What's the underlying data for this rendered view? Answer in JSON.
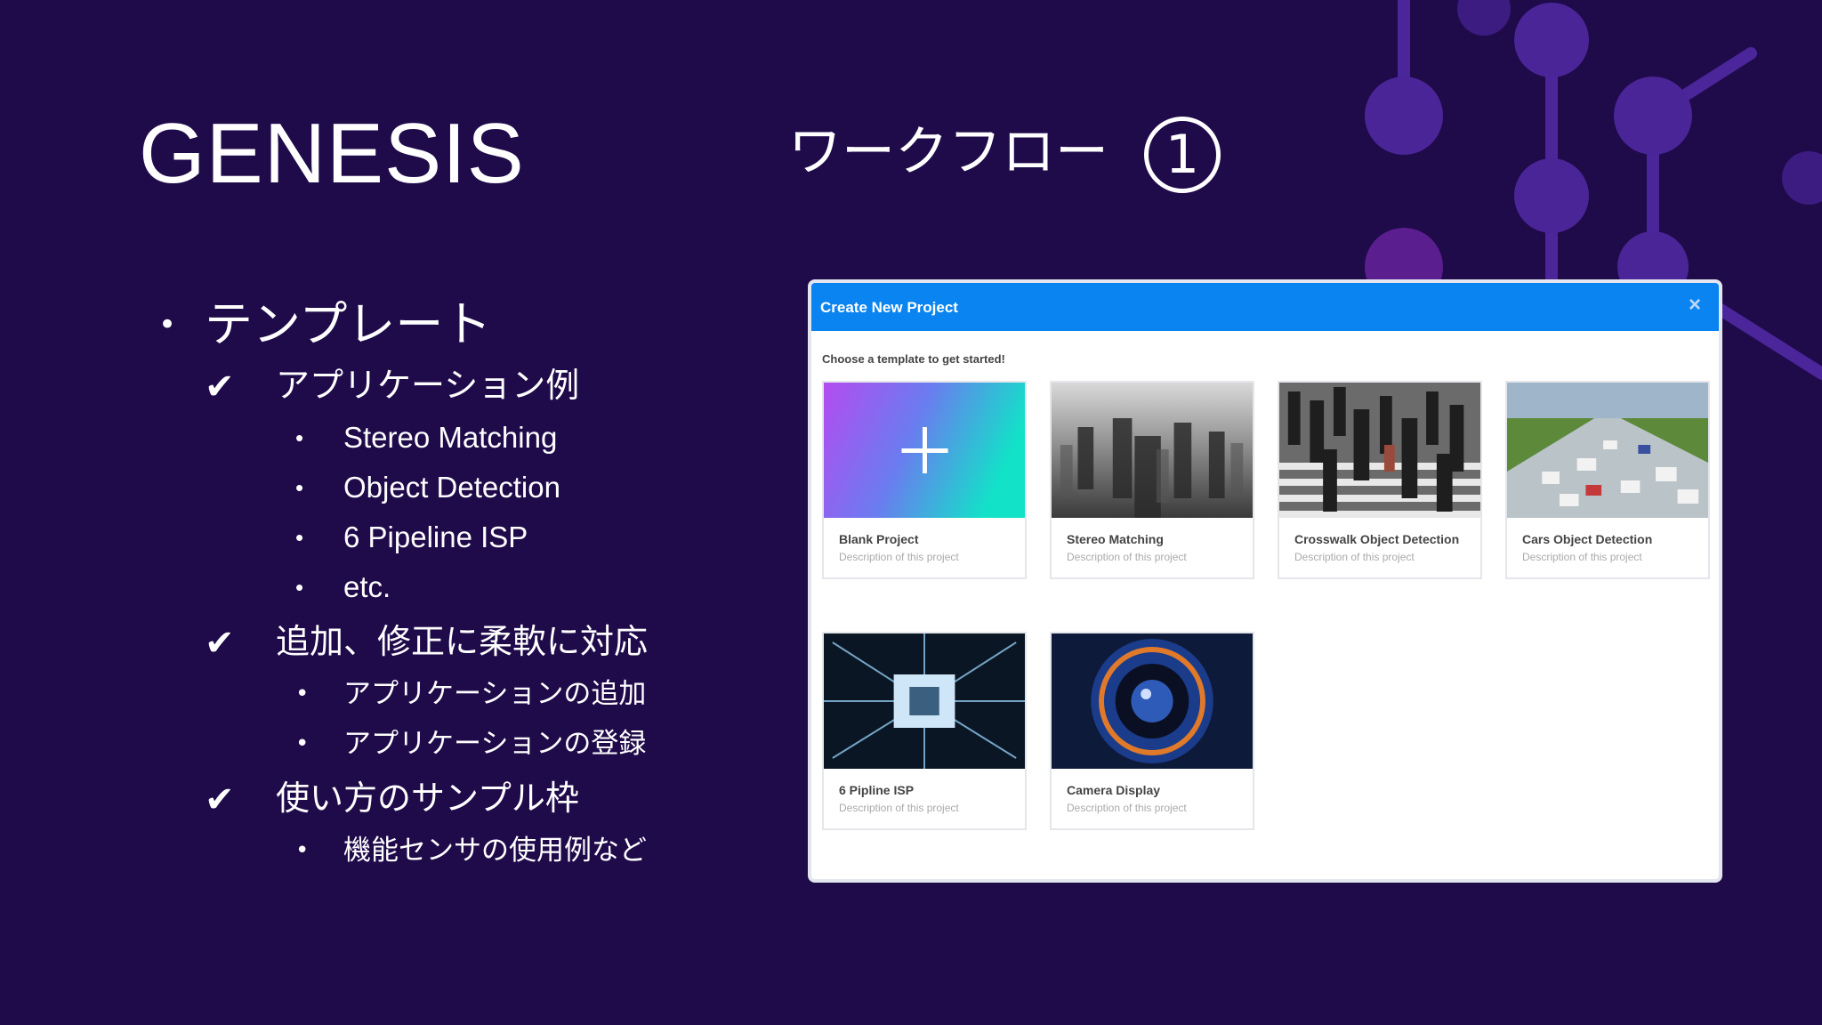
{
  "slide": {
    "title": "GENESIS",
    "subtitle": "ワークフロー",
    "subtitle_number": "1"
  },
  "outline": {
    "heading": "テンプレート",
    "sections": [
      {
        "label": "アプリケーション例",
        "items": [
          "Stereo Matching",
          "Object Detection",
          "6 Pipeline ISP",
          "etc."
        ]
      },
      {
        "label": "追加、修正に柔軟に対応",
        "items": [
          "アプリケーションの追加",
          "アプリケーションの登録"
        ]
      },
      {
        "label": "使い方のサンプル枠",
        "items": [
          "機能センサの使用例など"
        ]
      }
    ]
  },
  "modal": {
    "title": "Create New Project",
    "close_icon": "×",
    "prompt": "Choose a template to get started!",
    "templates": [
      {
        "name": "Blank Project",
        "description": "Description of this project",
        "icon": "plus-icon"
      },
      {
        "name": "Stereo Matching",
        "description": "Description of this project",
        "icon": "stereo-image"
      },
      {
        "name": "Crosswalk Object Detection",
        "description": "Description of this project",
        "icon": "crosswalk-image"
      },
      {
        "name": "Cars Object Detection",
        "description": "Description of this project",
        "icon": "highway-image"
      },
      {
        "name": "6 Pipline ISP",
        "description": "Description of this project",
        "icon": "chip-image"
      },
      {
        "name": "Camera Display",
        "description": "Description of this project",
        "icon": "camera-lens-image"
      }
    ]
  },
  "colors": {
    "background": "#1f0a4a",
    "modal_header": "#0a84f0",
    "deco_purple": "#5b2fa6"
  }
}
